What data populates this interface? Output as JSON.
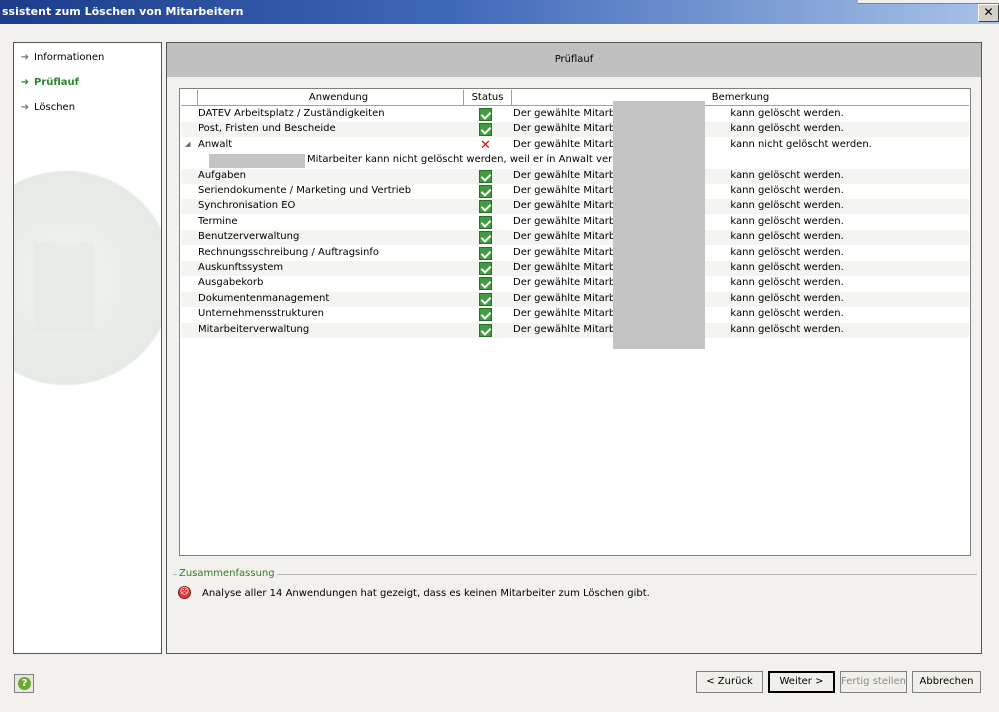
{
  "window": {
    "title": "ssistent zum Löschen von Mitarbeitern",
    "close_label": "✕"
  },
  "nav": {
    "items": [
      {
        "label": "Informationen",
        "active": false
      },
      {
        "label": "Prüflauf",
        "active": true
      },
      {
        "label": "Löschen",
        "active": false
      }
    ]
  },
  "page": {
    "title": "Prüflauf"
  },
  "grid": {
    "columns": [
      "Anwendung",
      "Status",
      "Bemerkung"
    ],
    "rows": [
      {
        "app": "DATEV Arbeitsplatz / Zuständigkeiten",
        "status": "ok",
        "remark_a": "Der gewählte Mitarbeiter",
        "remark_b": "kann gelöscht werden."
      },
      {
        "app": "Post, Fristen und Bescheide",
        "status": "ok",
        "remark_a": "Der gewählte Mitarbeiter",
        "remark_b": "kann gelöscht werden."
      },
      {
        "app": "Anwalt",
        "status": "error",
        "remark_a": "Der gewählte Mitarbeiter",
        "remark_b": "kann nicht gelöscht werden.",
        "detail": "Mitarbeiter kann nicht gelöscht werden, weil er in Anwalt verknüpft ist."
      },
      {
        "app": "Aufgaben",
        "status": "ok",
        "remark_a": "Der gewählte Mitarbeiter",
        "remark_b": "kann gelöscht werden."
      },
      {
        "app": "Seriendokumente / Marketing und Vertrieb",
        "status": "ok",
        "remark_a": "Der gewählte Mitarbeiter",
        "remark_b": "kann gelöscht werden."
      },
      {
        "app": "Synchronisation EO",
        "status": "ok",
        "remark_a": "Der gewählte Mitarbeiter",
        "remark_b": "kann gelöscht werden."
      },
      {
        "app": "Termine",
        "status": "ok",
        "remark_a": "Der gewählte Mitarbeiter",
        "remark_b": "kann gelöscht werden."
      },
      {
        "app": "Benutzerverwaltung",
        "status": "ok",
        "remark_a": "Der gewählte Mitarbeiter",
        "remark_b": "kann gelöscht werden."
      },
      {
        "app": "Rechnungsschreibung / Auftragsinfo",
        "status": "ok",
        "remark_a": "Der gewählte Mitarbeiter",
        "remark_b": "kann gelöscht werden."
      },
      {
        "app": "Auskunftssystem",
        "status": "ok",
        "remark_a": "Der gewählte Mitarbeiter",
        "remark_b": "kann gelöscht werden."
      },
      {
        "app": "Ausgabekorb",
        "status": "ok",
        "remark_a": "Der gewählte Mitarbeiter",
        "remark_b": "kann gelöscht werden."
      },
      {
        "app": "Dokumentenmanagement",
        "status": "ok",
        "remark_a": "Der gewählte Mitarbeiter",
        "remark_b": "kann gelöscht werden."
      },
      {
        "app": "Unternehmensstrukturen",
        "status": "ok",
        "remark_a": "Der gewählte Mitarbeiter",
        "remark_b": "kann gelöscht werden."
      },
      {
        "app": "Mitarbeiterverwaltung",
        "status": "ok",
        "remark_a": "Der gewählte Mitarbeiter",
        "remark_b": "kann gelöscht werden."
      }
    ]
  },
  "summary": {
    "legend": "Zusammenfassung",
    "text": "Analyse aller 14 Anwendungen hat gezeigt, dass es keinen Mitarbeiter zum Löschen gibt."
  },
  "buttons": {
    "back": "< Zurück",
    "next": "Weiter >",
    "finish": "Fertig stellen",
    "cancel": "Abbrechen"
  },
  "colors": {
    "titlebar": "#1b3c8a",
    "accent_green": "#2a8a2a",
    "error_red": "#d01010",
    "header_gray": "#c0c0c0"
  }
}
